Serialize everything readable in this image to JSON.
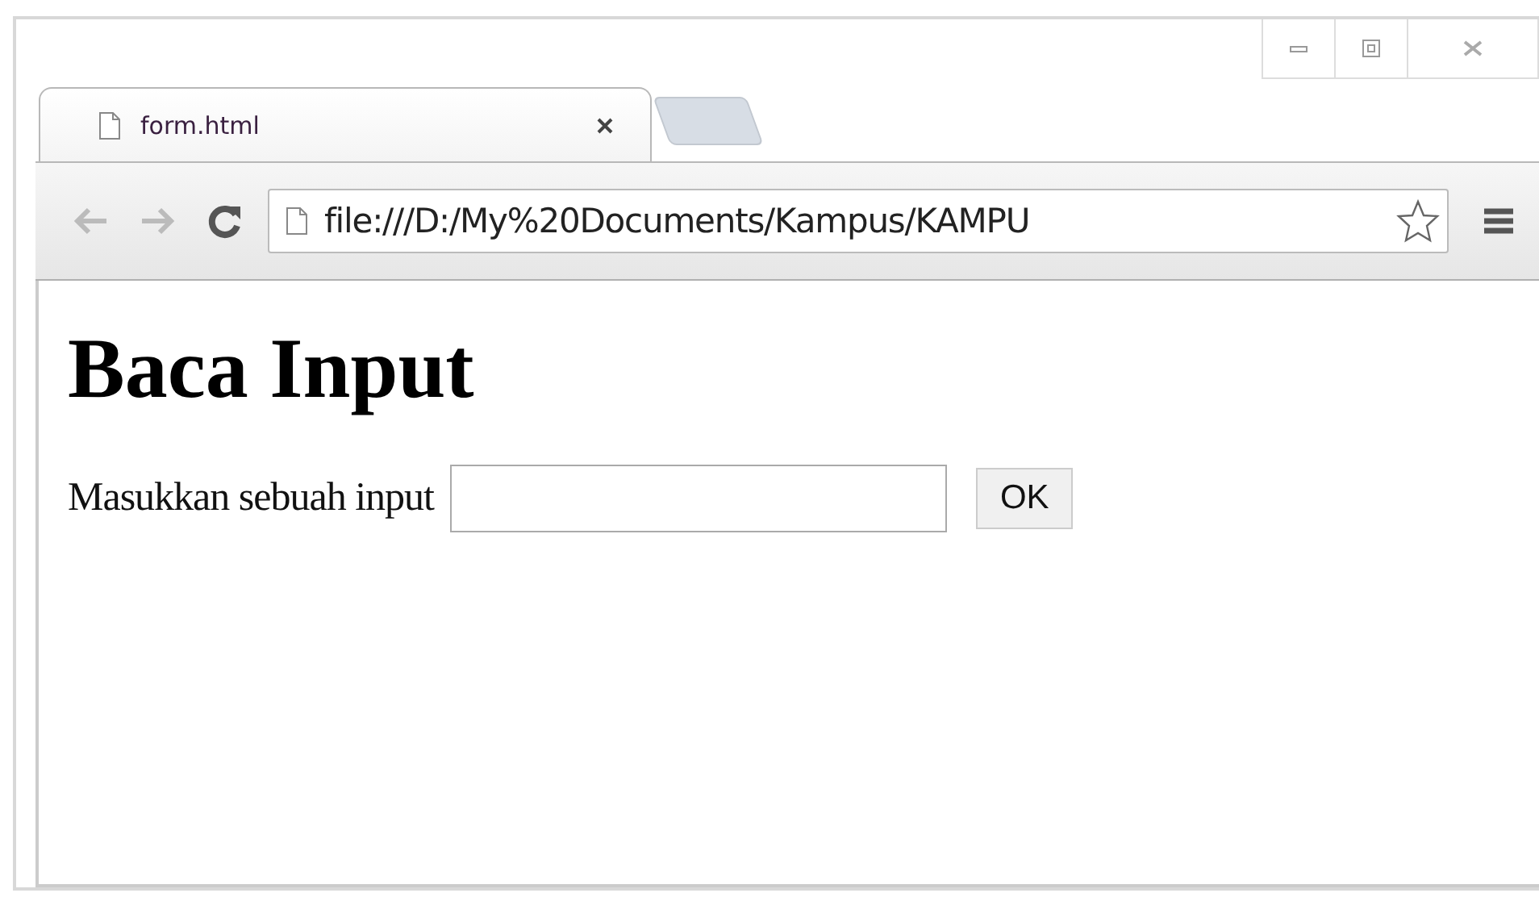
{
  "tabs": [
    {
      "label": "form.html",
      "selected": true
    }
  ],
  "address_bar": {
    "value": "file:///D:/My%20Documents/Kampus/KAMPU"
  },
  "page": {
    "heading": "Baca Input",
    "form": {
      "label": "Masukkan sebuah input",
      "button": "OK"
    }
  }
}
